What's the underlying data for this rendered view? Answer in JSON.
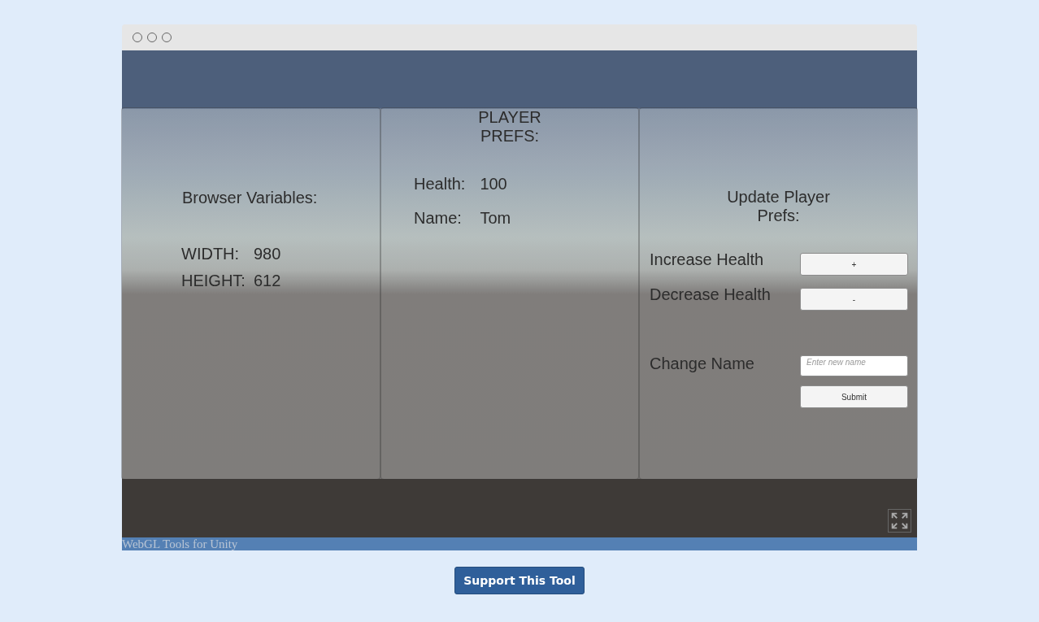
{
  "browser_panel": {
    "title": "Browser Variables:",
    "variables": [
      {
        "label": "WIDTH:",
        "value": "980"
      },
      {
        "label": "HEIGHT:",
        "value": "612"
      }
    ]
  },
  "prefs_panel": {
    "title": "PLAYER PREFS:",
    "prefs": [
      {
        "label": "Health:",
        "value": "100"
      },
      {
        "label": "Name:",
        "value": "Tom"
      }
    ]
  },
  "update_panel": {
    "title": "Update Player Prefs:",
    "rows": [
      {
        "kind": "button",
        "label": "Increase Health",
        "button": "+"
      },
      {
        "kind": "button",
        "label": "Decrease Health",
        "button": "-"
      },
      {
        "kind": "input",
        "label": "Change Name",
        "placeholder": "Enter new name"
      },
      {
        "kind": "submit",
        "button": "Submit"
      }
    ]
  },
  "footer_label": "WebGL Tools for Unity",
  "support_button": "Support This Tool"
}
